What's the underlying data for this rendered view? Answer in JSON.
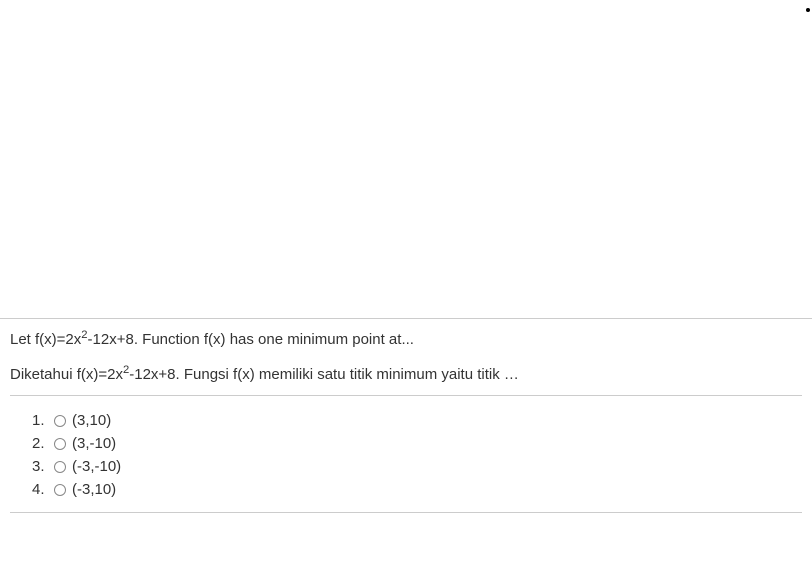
{
  "question": {
    "en_pre": "Let f(x)=2x",
    "en_exp": "2",
    "en_post": "-12x+8. Function f(x) has one minimum point at...",
    "id_pre": "Diketahui f(x)=2x",
    "id_exp": "2",
    "id_post": "-12x+8. Fungsi f(x) memiliki satu titik minimum yaitu titik …"
  },
  "options": [
    {
      "num": "1.",
      "label": "(3,10)"
    },
    {
      "num": "2.",
      "label": "(3,-10)"
    },
    {
      "num": "3.",
      "label": "(-3,-10)"
    },
    {
      "num": "4.",
      "label": "(-3,10)"
    }
  ]
}
